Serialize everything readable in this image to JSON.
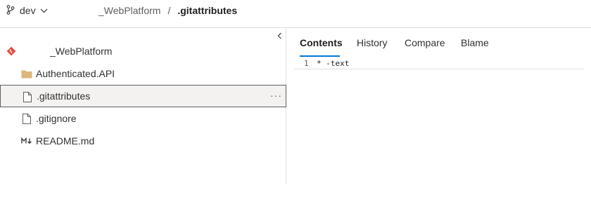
{
  "header": {
    "branch": "dev",
    "repo": "_WebPlatform",
    "separator": "/",
    "file": ".gitattributes"
  },
  "tree": {
    "repo_name": "_WebPlatform",
    "items": [
      {
        "name": "Authenticated.API",
        "icon": "folder-icon"
      },
      {
        "name": ".gitattributes",
        "icon": "file-icon",
        "selected": true,
        "more": "···"
      },
      {
        "name": ".gitignore",
        "icon": "file-icon"
      },
      {
        "name": "README.md",
        "icon": "markdown-icon"
      }
    ]
  },
  "tabs": [
    "Contents",
    "History",
    "Compare",
    "Blame"
  ],
  "active_tab": "Contents",
  "file_content": {
    "line_number": "1",
    "line_text": "* -text"
  },
  "colors": {
    "accent": "#0078d4",
    "git_icon": "#e74c3c",
    "folder": "#dcb67a"
  }
}
